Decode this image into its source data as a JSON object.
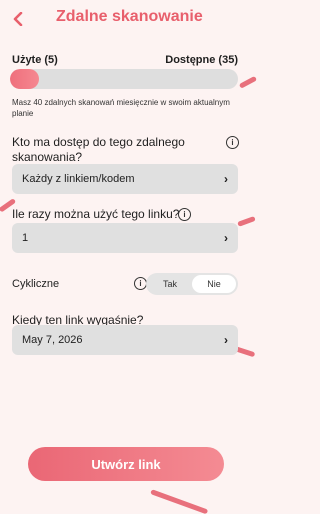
{
  "header": {
    "title": "Zdalne skanowanie"
  },
  "usage": {
    "used_label": "Użyte (5)",
    "available_label": "Dostępne (35)",
    "used_fraction": 0.125,
    "note": "Masz 40 zdalnych skanowań miesięcznie w swoim aktualnym planie"
  },
  "access": {
    "question": "Kto ma dostęp do tego zdalnego skanowania?",
    "value": "Każdy z linkiem/kodem"
  },
  "uses": {
    "question": "Ile razy można użyć tego linku?",
    "value": "1"
  },
  "recurring": {
    "label": "Cykliczne",
    "option_yes": "Tak",
    "option_no": "Nie",
    "selected": "Nie"
  },
  "expiry": {
    "question": "Kiedy ten link wygaśnie?",
    "value": "May 7, 2026"
  },
  "cta": {
    "label": "Utwórz link"
  },
  "colors": {
    "accent": "#e85f6c",
    "background": "#fdf3f2"
  },
  "icons": {
    "back": "chevron-left-icon",
    "info": "info-icon",
    "chevron": "chevron-right-icon"
  }
}
